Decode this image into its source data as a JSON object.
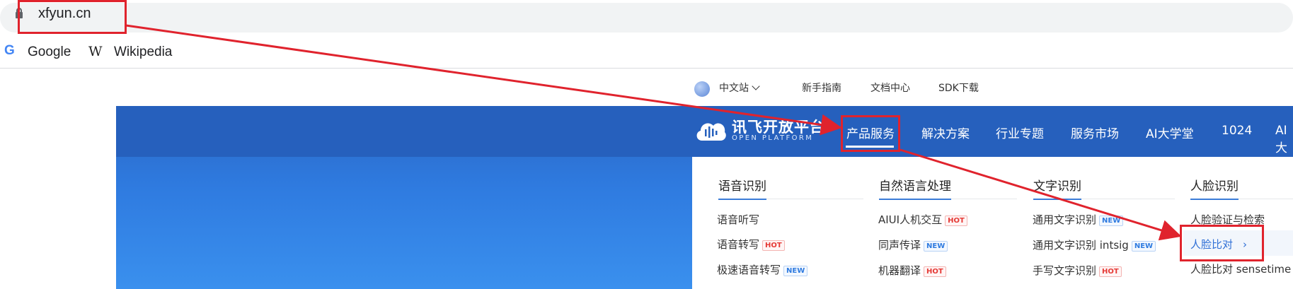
{
  "browser": {
    "url": "xfyun.cn",
    "bookmarks": [
      {
        "icon": "google-icon",
        "label": "Google"
      },
      {
        "icon": "wikipedia-icon",
        "label": "Wikipedia"
      }
    ]
  },
  "site": {
    "top_nav": {
      "language": "中文站",
      "links": [
        "新手指南",
        "文档中心",
        "SDK下载"
      ]
    },
    "logo": {
      "title": "讯飞开放平台",
      "subtitle": "OPEN PLATFORM"
    },
    "main_nav": [
      "产品服务",
      "解决方案",
      "行业专题",
      "服务市场",
      "AI大学堂",
      "1024",
      "AI大"
    ],
    "dropdown": {
      "columns": [
        {
          "heading": "语音识别",
          "items": [
            {
              "label": "语音听写",
              "tag": ""
            },
            {
              "label": "语音转写",
              "tag": "HOT"
            },
            {
              "label": "极速语音转写",
              "tag": "NEW"
            }
          ]
        },
        {
          "heading": "自然语言处理",
          "items": [
            {
              "label": "AIUI人机交互",
              "tag": "HOT"
            },
            {
              "label": "同声传译",
              "tag": "NEW"
            },
            {
              "label": "机器翻译",
              "tag": "HOT"
            }
          ]
        },
        {
          "heading": "文字识别",
          "items": [
            {
              "label": "通用文字识别",
              "tag": "NEW"
            },
            {
              "label": "通用文字识别 intsig",
              "tag": "NEW"
            },
            {
              "label": "手写文字识别",
              "tag": "HOT"
            }
          ]
        },
        {
          "heading": "人脸识别",
          "items": [
            {
              "label": "人脸验证与检索",
              "tag": ""
            },
            {
              "label": "人脸比对",
              "tag": ""
            },
            {
              "label": "人脸比对 sensetime",
              "tag": ""
            }
          ]
        }
      ],
      "active_item_arrow": "›"
    }
  },
  "colors": {
    "annotation": "#e0232d",
    "hero_blue": "#2f7be0",
    "link_blue": "#2f6fd6",
    "hot": "#e53935",
    "new": "#2f7be0"
  }
}
